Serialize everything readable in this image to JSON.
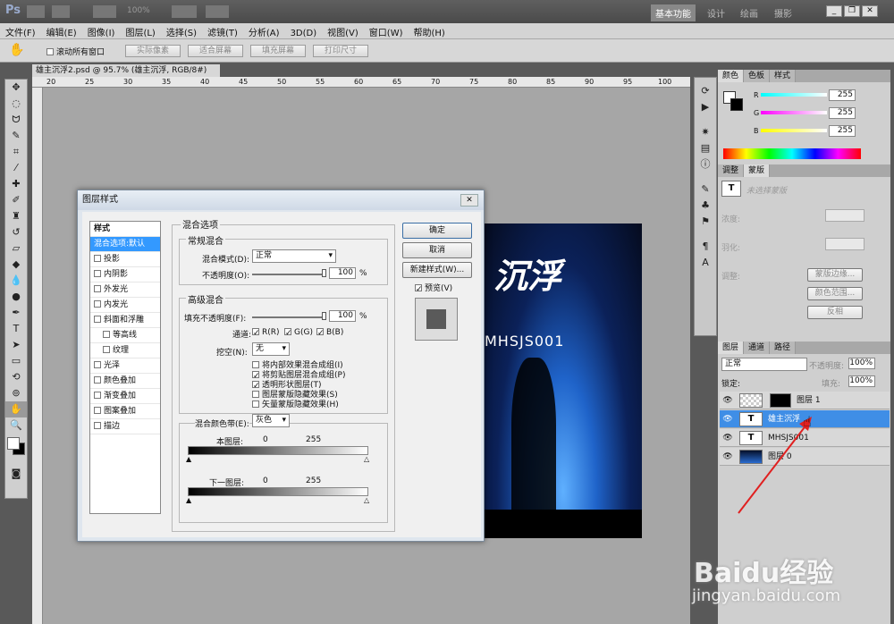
{
  "app": {
    "logo": "Ps",
    "zoom": "100%",
    "workspaces": [
      "基本功能",
      "设计",
      "绘画",
      "摄影"
    ],
    "active_workspace": "基本功能"
  },
  "menu": [
    "文件(F)",
    "编辑(E)",
    "图像(I)",
    "图层(L)",
    "选择(S)",
    "滤镜(T)",
    "分析(A)",
    "3D(D)",
    "视图(V)",
    "窗口(W)",
    "帮助(H)"
  ],
  "options": {
    "scroll_all": "滚动所有窗口",
    "buttons": [
      "实际像素",
      "适合屏幕",
      "填充屏幕",
      "打印尺寸"
    ]
  },
  "doc": {
    "tab": "雄主沉浮2.psd @ 95.7% (雄主沉浮, RGB/8#) *",
    "ruler": [
      "20",
      "25",
      "30",
      "35",
      "40",
      "45",
      "50",
      "55",
      "60",
      "65",
      "70",
      "75",
      "80",
      "85",
      "90",
      "95",
      "100"
    ],
    "art_title": "沉浮",
    "art_sub": "MHSJS001"
  },
  "color_panel": {
    "tabs": [
      "颜色",
      "色板",
      "样式"
    ],
    "channels": [
      {
        "k": "R",
        "v": "255",
        "c": "#00d0d0"
      },
      {
        "k": "G",
        "v": "255",
        "c": "#d000d0"
      },
      {
        "k": "B",
        "v": "255",
        "c": "#d0d000"
      }
    ]
  },
  "adjust_panel": {
    "tabs": [
      "调整",
      "蒙版"
    ],
    "placeholder": "未选择蒙版",
    "density": "浓度:",
    "feather": "羽化:",
    "refine": "调整:",
    "buttons": [
      "蒙版边缘...",
      "颜色范围...",
      "反相"
    ]
  },
  "layers_panel": {
    "tabs": [
      "图层",
      "通道",
      "路径"
    ],
    "blend": "正常",
    "opacity_label": "不透明度:",
    "opacity": "100%",
    "lock_label": "锁定:",
    "fill_label": "填充:",
    "fill": "100%",
    "layers": [
      {
        "name": "图层 1",
        "thumb": "",
        "sel": false
      },
      {
        "name": "雄主沉浮",
        "thumb": "T",
        "sel": true
      },
      {
        "name": "MHSJS001",
        "thumb": "T",
        "sel": false
      },
      {
        "name": "图层 0",
        "thumb": "",
        "sel": false
      }
    ]
  },
  "dialog": {
    "title": "图层样式",
    "styles_header": "样式",
    "styles": [
      {
        "label": "混合选项:默认",
        "sel": true,
        "cb": false
      },
      {
        "label": "投影",
        "cb": true
      },
      {
        "label": "内阴影",
        "cb": true
      },
      {
        "label": "外发光",
        "cb": true
      },
      {
        "label": "内发光",
        "cb": true
      },
      {
        "label": "斜面和浮雕",
        "cb": true
      },
      {
        "label": "等高线",
        "cb": true,
        "sub": true
      },
      {
        "label": "纹理",
        "cb": true,
        "sub": true
      },
      {
        "label": "光泽",
        "cb": true
      },
      {
        "label": "颜色叠加",
        "cb": true
      },
      {
        "label": "渐变叠加",
        "cb": true
      },
      {
        "label": "图案叠加",
        "cb": true
      },
      {
        "label": "描边",
        "cb": true
      }
    ],
    "blend_options": "混合选项",
    "general": "常规混合",
    "blend_mode_label": "混合模式(D):",
    "blend_mode": "正常",
    "opacity_label": "不透明度(O):",
    "opacity": "100",
    "pct": "%",
    "advanced": "高级混合",
    "fill_opacity_label": "填充不透明度(F):",
    "fill_opacity": "100",
    "channels_label": "通道:",
    "ch": [
      "R(R)",
      "G(G)",
      "B(B)"
    ],
    "knockout_label": "挖空(N):",
    "knockout": "无",
    "checks": [
      {
        "l": "将内部效果混合成组(I)",
        "c": false
      },
      {
        "l": "将剪贴图层混合成组(P)",
        "c": true
      },
      {
        "l": "透明形状图层(T)",
        "c": true
      },
      {
        "l": "图层蒙版隐藏效果(S)",
        "c": false
      },
      {
        "l": "矢量蒙版隐藏效果(H)",
        "c": false
      }
    ],
    "blend_if_label": "混合颜色带(E):",
    "blend_if": "灰色",
    "this_layer": "本图层:",
    "under_layer": "下一图层:",
    "v0": "0",
    "v255": "255",
    "ok": "确定",
    "cancel": "取消",
    "new_style": "新建样式(W)...",
    "preview": "预览(V)"
  },
  "watermark": {
    "brand": "Baidu经验",
    "url": "jingyan.baidu.com"
  }
}
